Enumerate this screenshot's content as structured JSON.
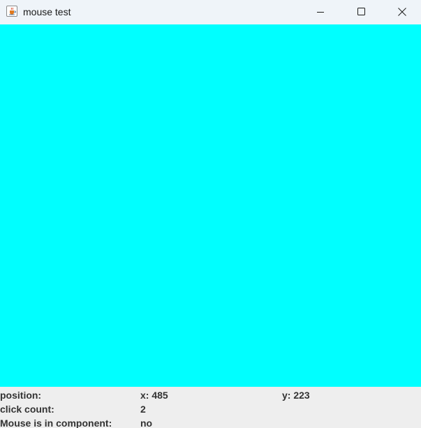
{
  "window": {
    "title": "mouse test",
    "app_icon": "java-cup-icon",
    "controls": [
      "minimize-icon",
      "maximize-icon",
      "close-icon"
    ]
  },
  "canvas": {
    "background_color": "#00ffff"
  },
  "status": {
    "position_label": "position:",
    "x_value": "x: 485",
    "y_value": "y: 223",
    "click_count_label": "click count:",
    "click_count_value": "2",
    "in_component_label": "Mouse is in component:",
    "in_component_value": "no"
  }
}
